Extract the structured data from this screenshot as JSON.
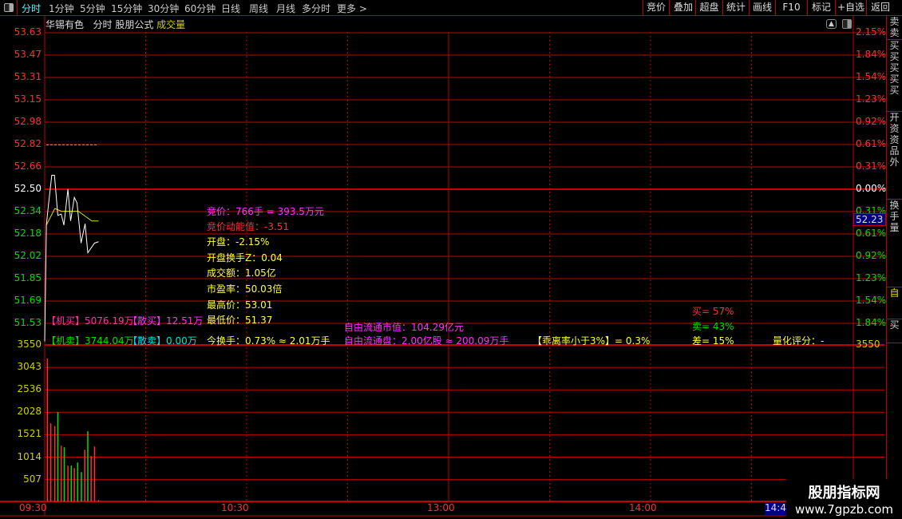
{
  "toolbar": {
    "periods": [
      "分时",
      "1分钟",
      "5分钟",
      "15分钟",
      "30分钟",
      "60分钟",
      "日线",
      "周线",
      "月线",
      "多分时",
      "更多 >"
    ],
    "active_period": "分时",
    "buttons": [
      "竞价",
      "叠加",
      "超盘",
      "统计",
      "画线",
      "F10",
      "标记",
      "+自选",
      "返回"
    ]
  },
  "header": {
    "stock_name": "华锡有色",
    "view": "分时",
    "formula": "股朋公式",
    "indicator": "成交量"
  },
  "price_axis": {
    "labels": [
      "53.63",
      "53.47",
      "53.31",
      "53.15",
      "52.98",
      "52.82",
      "52.66",
      "52.50",
      "52.34",
      "52.18",
      "52.02",
      "51.85",
      "51.69",
      "51.53"
    ]
  },
  "pct_axis": {
    "labels": [
      "2.15%",
      "1.84%",
      "1.54%",
      "1.23%",
      "0.92%",
      "0.61%",
      "0.31%",
      "0.00%",
      "0.31%",
      "0.61%",
      "0.92%",
      "1.23%",
      "1.54%",
      "1.84%"
    ]
  },
  "volume_axis": {
    "labels": [
      "3550",
      "3043",
      "2536",
      "2028",
      "1521",
      "1014",
      "507"
    ]
  },
  "time_axis": {
    "labels": [
      "09:30",
      "10:30",
      "13:00",
      "14:00"
    ],
    "cursor_time": "14:4"
  },
  "current_price": "52.23",
  "colors": {
    "up": "#ff3030",
    "down": "#00e000",
    "flat": "#ffffff",
    "grid": "#c00000",
    "avg_line": "#e0e000",
    "price_line": "#ffffff",
    "volume_label": "#d0d000"
  },
  "chart_data": {
    "type": "line",
    "prev_close": 52.5,
    "y_range": [
      51.53,
      53.63
    ],
    "x_range_minutes": [
      0,
      240
    ],
    "price_series": [
      [
        0,
        51.4
      ],
      [
        0.5,
        52.24
      ],
      [
        1,
        52.36
      ],
      [
        2.1,
        52.6
      ],
      [
        2.9,
        52.6
      ],
      [
        3.9,
        52.31
      ],
      [
        4.9,
        52.32
      ],
      [
        5.7,
        52.24
      ],
      [
        6.9,
        52.5
      ],
      [
        7.7,
        52.27
      ],
      [
        8.8,
        52.44
      ],
      [
        9.6,
        52.4
      ],
      [
        10.8,
        52.11
      ],
      [
        12,
        52.25
      ],
      [
        12.8,
        52.04
      ],
      [
        14.8,
        52.11
      ],
      [
        16,
        52.12
      ]
    ],
    "avg_series": [
      [
        0.5,
        52.24
      ],
      [
        3,
        52.36
      ],
      [
        5,
        52.34
      ],
      [
        10,
        52.34
      ],
      [
        14,
        52.27
      ],
      [
        16,
        52.27
      ]
    ],
    "marker_price": 52.82,
    "volume_range": [
      0,
      3550
    ],
    "volume": [
      {
        "min": 0.8,
        "v": 3242,
        "dir": "up"
      },
      {
        "min": 1.8,
        "v": 1772,
        "dir": "up"
      },
      {
        "min": 3,
        "v": 1712,
        "dir": "up"
      },
      {
        "min": 3.9,
        "v": 2026,
        "dir": "down"
      },
      {
        "min": 4.9,
        "v": 1264,
        "dir": "up"
      },
      {
        "min": 5.8,
        "v": 1228,
        "dir": "down"
      },
      {
        "min": 6.9,
        "v": 811,
        "dir": "up"
      },
      {
        "min": 7.9,
        "v": 811,
        "dir": "down"
      },
      {
        "min": 8.8,
        "v": 756,
        "dir": "up"
      },
      {
        "min": 9.8,
        "v": 883,
        "dir": "down"
      },
      {
        "min": 10.9,
        "v": 666,
        "dir": "down"
      },
      {
        "min": 11.9,
        "v": 1174,
        "dir": "up"
      },
      {
        "min": 12.8,
        "v": 1591,
        "dir": "down"
      },
      {
        "min": 13.8,
        "v": 1029,
        "dir": "up"
      },
      {
        "min": 14.8,
        "v": 1246,
        "dir": "up"
      },
      {
        "min": 16,
        "v": 31,
        "dir": "up"
      }
    ]
  },
  "info": {
    "auction": "竞价：766手 = 393.5万元",
    "auction_momentum": "竞价动能值：-3.51",
    "open": "开盘：-2.15%",
    "open_turnover": "开盘换手Z：0.04",
    "amount": "成交额：1.05亿",
    "pe": "市盈率：50.03倍",
    "high": "最高价：53.01",
    "low": "最低价：51.37",
    "turnover": "今换手：0.73% ≈ 2.01万手",
    "float_value": "自由流通市值：104.29亿元",
    "float_shares": "自由流通盘：2.00亿股 ≈ 200.09万手",
    "deviation": "【乖离率小于3%】= 0.3%",
    "buy_pct": "买= 57%",
    "sell_pct": "卖= 43%",
    "diff_pct": "差= 15%",
    "quant_score": "量化评分：-",
    "inst_buy": "【机买】5076.19万",
    "retail_buy": "【散买】12.51万",
    "inst_sell": "【机卖】3744.04万",
    "retail_sell": "【散卖】0.00万"
  },
  "right_strip": {
    "tabs": [
      "卖卖卖卖卖",
      "买买买买买",
      "开资资品外",
      "换手量",
      "自",
      "买"
    ]
  },
  "watermark": {
    "title": "股朋指标网",
    "url": "www.7gpzb.com"
  }
}
